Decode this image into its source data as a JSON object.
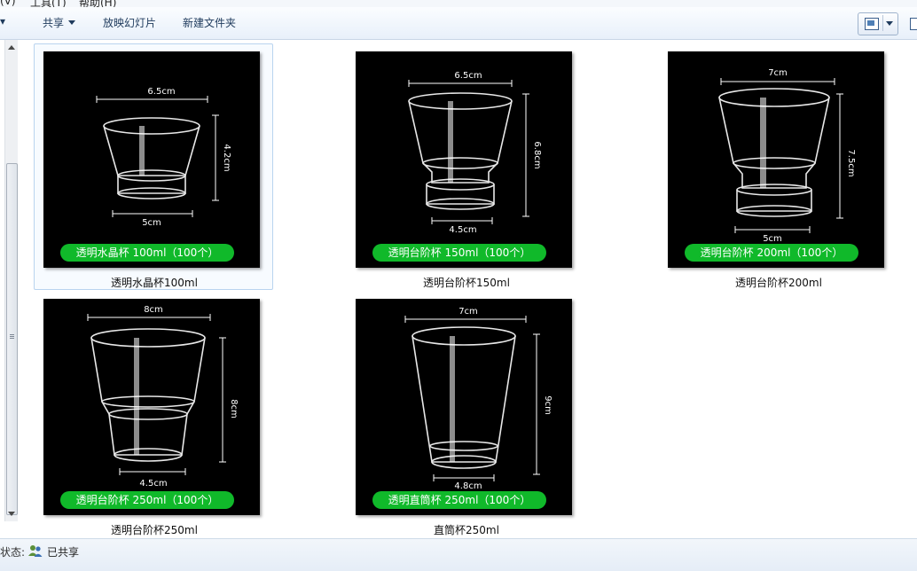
{
  "menubar": {
    "items": [
      "(V)",
      "工具(T)",
      "帮助(H)"
    ]
  },
  "toolbar": {
    "organize_fragment": "▾",
    "share": "共享",
    "slideshow": "放映幻灯片",
    "new_folder": "新建文件夹"
  },
  "files": [
    {
      "name": "透明水晶杯100ml",
      "label": "透明水晶杯  100ml（100个）",
      "top_dim": "6.5cm",
      "side_dim": "4.2cm",
      "bottom_dim": "5cm",
      "selected": true
    },
    {
      "name": "透明台阶杯150ml",
      "label": "透明台阶杯  150ml（100个）",
      "top_dim": "6.5cm",
      "side_dim": "6.8cm",
      "bottom_dim": "4.5cm",
      "selected": false
    },
    {
      "name": "透明台阶杯200ml",
      "label": "透明台阶杯  200ml（100个）",
      "top_dim": "7cm",
      "side_dim": "7.5cm",
      "bottom_dim": "5cm",
      "selected": false
    },
    {
      "name": "透明台阶杯250ml",
      "label": "透明台阶杯  250ml（100个）",
      "top_dim": "8cm",
      "side_dim": "8cm",
      "bottom_dim": "4.5cm",
      "selected": false
    },
    {
      "name": "直筒杯250ml",
      "label": "透明直筒杯  250ml（100个）",
      "top_dim": "7cm",
      "side_dim": "9cm",
      "bottom_dim": "4.8cm",
      "selected": false
    }
  ],
  "statusbar": {
    "label": "状态:",
    "text": "已共享"
  },
  "colors": {
    "label_pill": "#10b92a",
    "thumb_bg": "#000000",
    "selection_border": "#b9d4ef"
  }
}
